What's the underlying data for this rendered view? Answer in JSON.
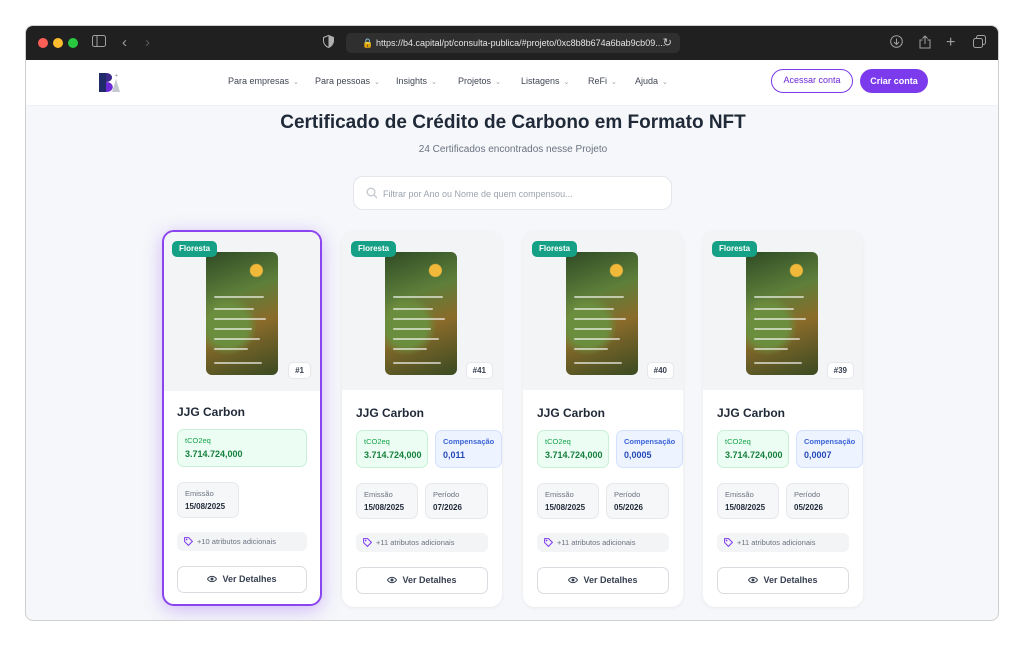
{
  "browser": {
    "url": "https://b4.capital/pt/consulta-publica/#projeto/0xc8b8b674a6bab9cb09...."
  },
  "nav": {
    "items": [
      "Para empresas",
      "Para pessoas",
      "Insights",
      "Projetos",
      "Listagens",
      "ReFi",
      "Ajuda"
    ],
    "login_label": "Acessar conta",
    "signup_label": "Criar conta"
  },
  "page": {
    "title": "Certificado de Crédito de Carbono em Formato NFT",
    "subtitle": "24 Certificados encontrados nesse Projeto",
    "search_placeholder": "Filtrar por Ano ou Nome de quem compensou..."
  },
  "cards": [
    {
      "tag": "Floresta",
      "number": "#1",
      "title": "JJG Carbon",
      "tco2_label": "tCO2eq",
      "tco2_value": "3.714.724,000",
      "emissao_label": "Emissão",
      "emissao_value": "15/08/2025",
      "attributes": "+10 atributos adicionais",
      "details_label": "Ver Detalhes"
    },
    {
      "tag": "Floresta",
      "number": "#41",
      "title": "JJG Carbon",
      "tco2_label": "tCO2eq",
      "tco2_value": "3.714.724,000",
      "comp_label": "Compensação",
      "comp_value": "0,011",
      "emissao_label": "Emissão",
      "emissao_value": "15/08/2025",
      "periodo_label": "Período",
      "periodo_value": "07/2026",
      "attributes": "+11 atributos adicionais",
      "details_label": "Ver Detalhes"
    },
    {
      "tag": "Floresta",
      "number": "#40",
      "title": "JJG Carbon",
      "tco2_label": "tCO2eq",
      "tco2_value": "3.714.724,000",
      "comp_label": "Compensação",
      "comp_value": "0,0005",
      "emissao_label": "Emissão",
      "emissao_value": "15/08/2025",
      "periodo_label": "Período",
      "periodo_value": "05/2026",
      "attributes": "+11 atributos adicionais",
      "details_label": "Ver Detalhes"
    },
    {
      "tag": "Floresta",
      "number": "#39",
      "title": "JJG Carbon",
      "tco2_label": "tCO2eq",
      "tco2_value": "3.714.724,000",
      "comp_label": "Compensação",
      "comp_value": "0,0007",
      "emissao_label": "Emissão",
      "emissao_value": "15/08/2025",
      "periodo_label": "Período",
      "periodo_value": "05/2026",
      "attributes": "+11 atributos adicionais",
      "details_label": "Ver Detalhes"
    }
  ],
  "colors": {
    "accent": "#7c3aed",
    "tag": "#16a085",
    "green_box": "#ecfdf3",
    "blue_box": "#eef4ff"
  }
}
